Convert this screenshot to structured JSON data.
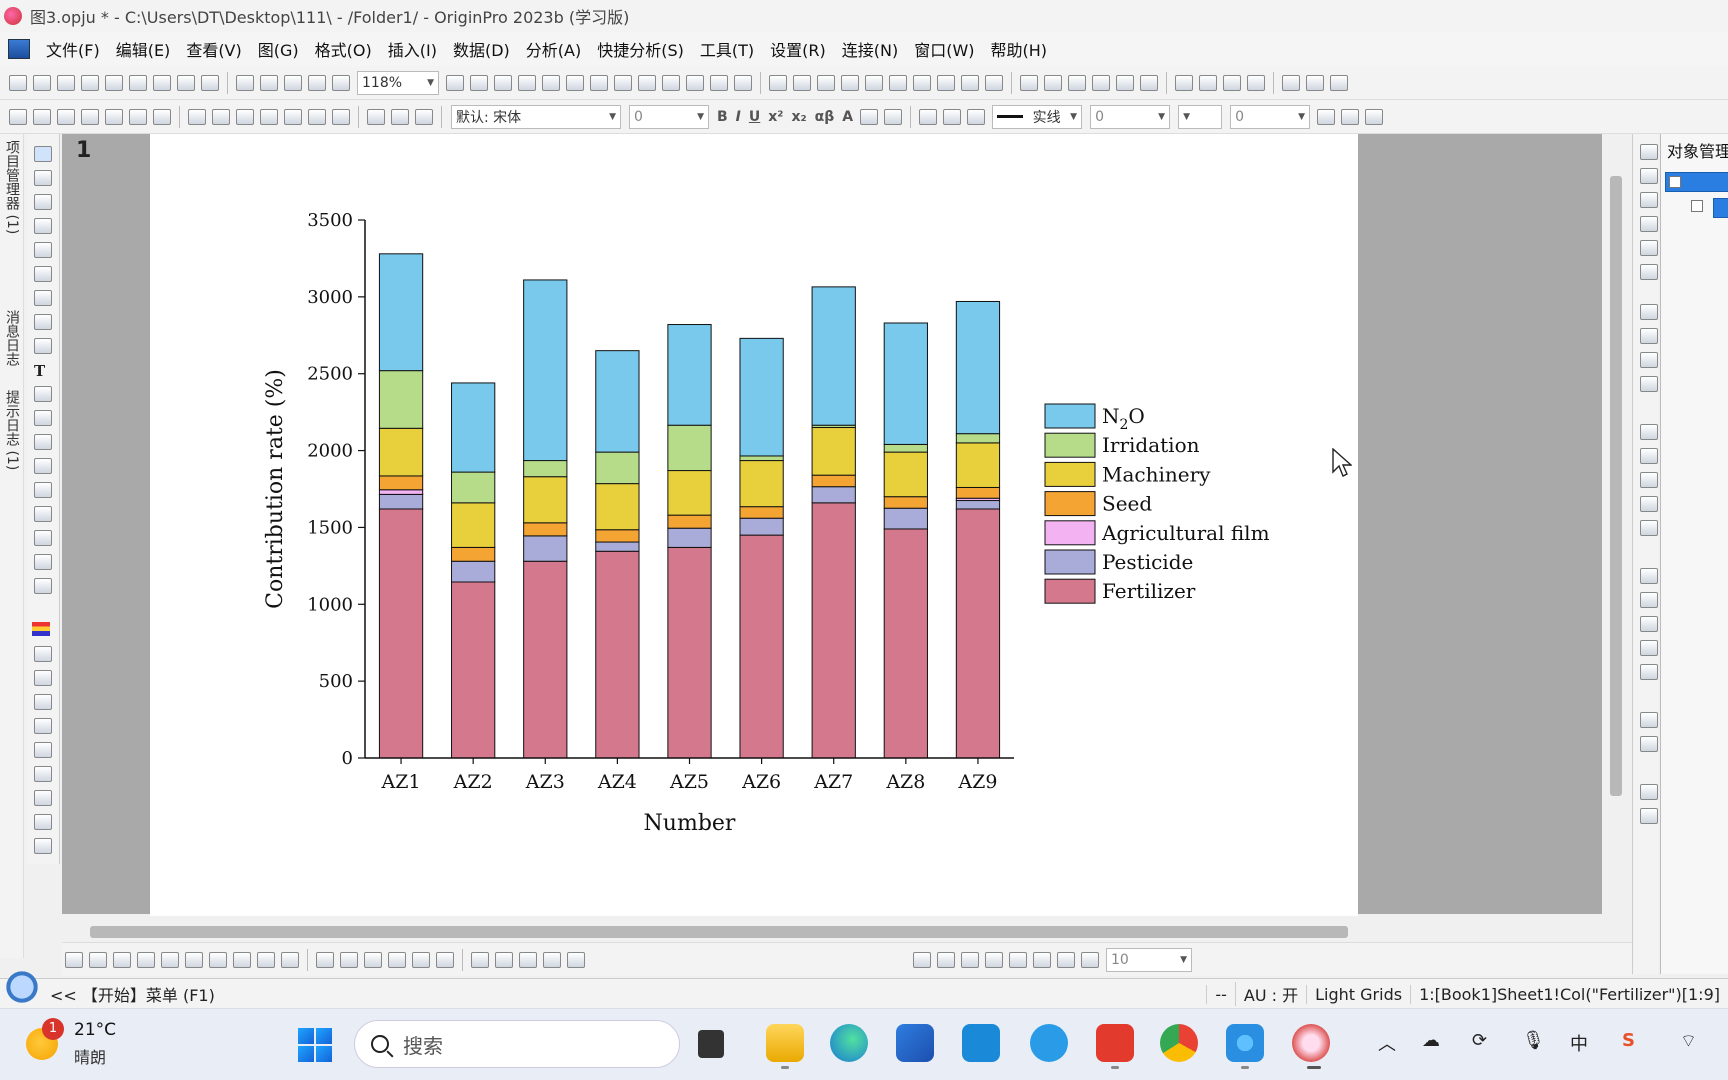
{
  "window": {
    "title": "图3.opju * - C:\\Users\\DT\\Desktop\\111\\ - /Folder1/ - OriginPro 2023b (学习版)"
  },
  "menu": {
    "items": [
      "文件(F)",
      "编辑(E)",
      "查看(V)",
      "图(G)",
      "格式(O)",
      "插入(I)",
      "数据(D)",
      "分析(A)",
      "快捷分析(S)",
      "工具(T)",
      "设置(R)",
      "连接(N)",
      "窗口(W)",
      "帮助(H)"
    ]
  },
  "toolbar": {
    "zoom": "118%",
    "font_name": "默认: 宋体",
    "font_size": "0",
    "line_style": "实线",
    "line_width": "0",
    "fill_value": "0",
    "bottom_value": "10"
  },
  "side_tabs": {
    "project_manager": "项目管理器 (1)",
    "message_log": "消息日志",
    "hint_log": "提示日志 (1)"
  },
  "graph": {
    "number": "1"
  },
  "object_manager": {
    "title": "对象管理"
  },
  "chart_data": {
    "type": "bar",
    "stacked": true,
    "title": "",
    "xlabel": "Number",
    "ylabel": "Contribution rate (%)",
    "ylim": [
      0,
      3500
    ],
    "yticks": [
      "0",
      "500",
      "1000",
      "1500",
      "2000",
      "2500",
      "3000",
      "3500"
    ],
    "categories": [
      "AZ1",
      "AZ2",
      "AZ3",
      "AZ4",
      "AZ5",
      "AZ6",
      "AZ7",
      "AZ8",
      "AZ9"
    ],
    "legend_position": "right",
    "series": [
      {
        "name": "Fertilizer",
        "color": "#d4788e",
        "values": [
          1620,
          1145,
          1280,
          1345,
          1370,
          1450,
          1660,
          1490,
          1620
        ]
      },
      {
        "name": "Pesticide",
        "color": "#a9acd8",
        "values": [
          95,
          135,
          165,
          60,
          125,
          110,
          105,
          135,
          55
        ]
      },
      {
        "name": "Agricultural film",
        "color": "#f3b2f2",
        "values": [
          30,
          0,
          0,
          0,
          0,
          0,
          0,
          0,
          15
        ]
      },
      {
        "name": "Seed",
        "color": "#f3a433",
        "values": [
          90,
          90,
          85,
          80,
          85,
          75,
          75,
          75,
          70
        ]
      },
      {
        "name": "Machinery",
        "color": "#e8cf3c",
        "values": [
          310,
          290,
          300,
          300,
          290,
          300,
          310,
          290,
          290
        ]
      },
      {
        "name": "Irridation",
        "color": "#b6dc8a",
        "values": [
          375,
          200,
          105,
          205,
          295,
          30,
          15,
          50,
          60
        ]
      },
      {
        "name": "N2O",
        "color": "#78c9ec",
        "values": [
          760,
          580,
          1175,
          660,
          655,
          765,
          900,
          790,
          860
        ]
      }
    ],
    "legend_labels": {
      "N2O_base": "N",
      "N2O_sub": "2",
      "N2O_tail": "O"
    }
  },
  "status": {
    "start_menu": "<< 【开始】菜单 (F1)",
    "dash": "--",
    "au": "AU : 开",
    "grids": "Light Grids",
    "cell": "1:[Book1]Sheet1!Col(\"Fertilizer\")[1:9]"
  },
  "taskbar": {
    "weather_badge": "1",
    "temperature": "21°C",
    "condition": "晴朗",
    "search_placeholder": "搜索",
    "ime": "中"
  }
}
